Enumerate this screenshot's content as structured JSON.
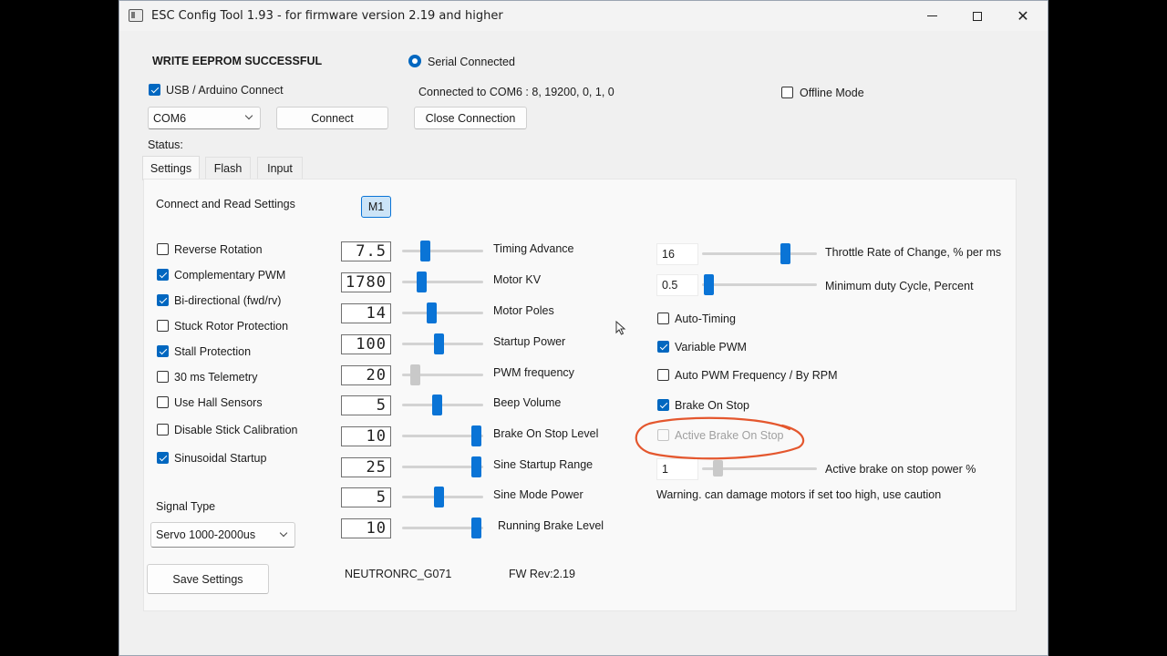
{
  "window": {
    "title": "ESC Config Tool 1.93 - for firmware version 2.19 and higher",
    "controls": {
      "minimize": "—",
      "maximize": "□",
      "close": "✕"
    }
  },
  "header": {
    "status_message": "WRITE EEPROM SUCCESSFUL",
    "serial_connected_label": "Serial Connected",
    "usb_arduino_label": "USB / Arduino Connect",
    "usb_arduino_checked": true,
    "connection_info": "Connected to COM6 : 8, 19200, 0, 1, 0",
    "offline_mode_label": "Offline Mode",
    "offline_mode_checked": false,
    "port_select": "COM6",
    "connect_label": "Connect",
    "close_connection_label": "Close Connection",
    "status_label": "Status:"
  },
  "tabs": [
    {
      "label": "Settings",
      "active": true
    },
    {
      "label": "Flash",
      "active": false
    },
    {
      "label": "Input",
      "active": false
    }
  ],
  "settings": {
    "connect_read_label": "Connect and Read Settings",
    "motor_button_label": "M1",
    "checkboxes": [
      {
        "label": "Reverse Rotation",
        "checked": false
      },
      {
        "label": "Complementary PWM",
        "checked": true
      },
      {
        "label": "Bi-directional (fwd/rv)",
        "checked": true
      },
      {
        "label": "Stuck Rotor Protection",
        "checked": false
      },
      {
        "label": "Stall Protection",
        "checked": true
      },
      {
        "label": "30 ms Telemetry",
        "checked": false
      },
      {
        "label": "Use Hall Sensors",
        "checked": false
      },
      {
        "label": "Disable Stick Calibration",
        "checked": false
      },
      {
        "label": "Sinusoidal Startup",
        "checked": true
      }
    ],
    "signal_type_label": "Signal Type",
    "signal_type_value": "Servo 1000-2000us",
    "save_label": "Save Settings",
    "device_name": "NEUTRONRC_G071",
    "fw_rev": "FW Rev:2.19",
    "sliders": [
      {
        "label": "Timing Advance",
        "display": "7.5",
        "position": 0.25,
        "enabled": true
      },
      {
        "label": "Motor KV",
        "display": "1780",
        "position": 0.2,
        "enabled": true
      },
      {
        "label": "Motor Poles",
        "display": "14",
        "position": 0.35,
        "enabled": true
      },
      {
        "label": "Startup Power",
        "display": "100",
        "position": 0.45,
        "enabled": true
      },
      {
        "label": "PWM frequency",
        "display": "20",
        "position": 0.12,
        "enabled": false
      },
      {
        "label": "Beep Volume",
        "display": "5",
        "position": 0.42,
        "enabled": true
      },
      {
        "label": "Brake On Stop Level",
        "display": "10",
        "position": 0.97,
        "enabled": true
      },
      {
        "label": "Sine Startup Range",
        "display": "25",
        "position": 0.97,
        "enabled": true
      },
      {
        "label": "Sine Mode Power",
        "display": "5",
        "position": 0.45,
        "enabled": true
      },
      {
        "label": "Running Brake Level",
        "display": "10",
        "position": 0.97,
        "enabled": true
      }
    ],
    "right": {
      "throttle_rate": {
        "value": "16",
        "label": "Throttle Rate of Change, % per ms",
        "position": 0.75
      },
      "min_duty": {
        "value": "0.5",
        "label": "Minimum duty Cycle, Percent",
        "position": 0.02
      },
      "checkboxes": [
        {
          "label": "Auto-Timing",
          "checked": false,
          "enabled": true
        },
        {
          "label": "Variable PWM",
          "checked": true,
          "enabled": true
        },
        {
          "label": "Auto PWM Frequency / By RPM",
          "checked": false,
          "enabled": true
        },
        {
          "label": "Brake On Stop",
          "checked": true,
          "enabled": true
        },
        {
          "label": "Active Brake On Stop",
          "checked": false,
          "enabled": false
        }
      ],
      "active_brake_power": {
        "value": "1",
        "label": "Active brake on stop power %",
        "position": 0.1
      },
      "warning": "Warning. can damage motors if set too high, use caution"
    }
  },
  "colors": {
    "accent": "#0067c0",
    "slider_thumb": "#0a74d6",
    "annotation": "#e4572e"
  }
}
